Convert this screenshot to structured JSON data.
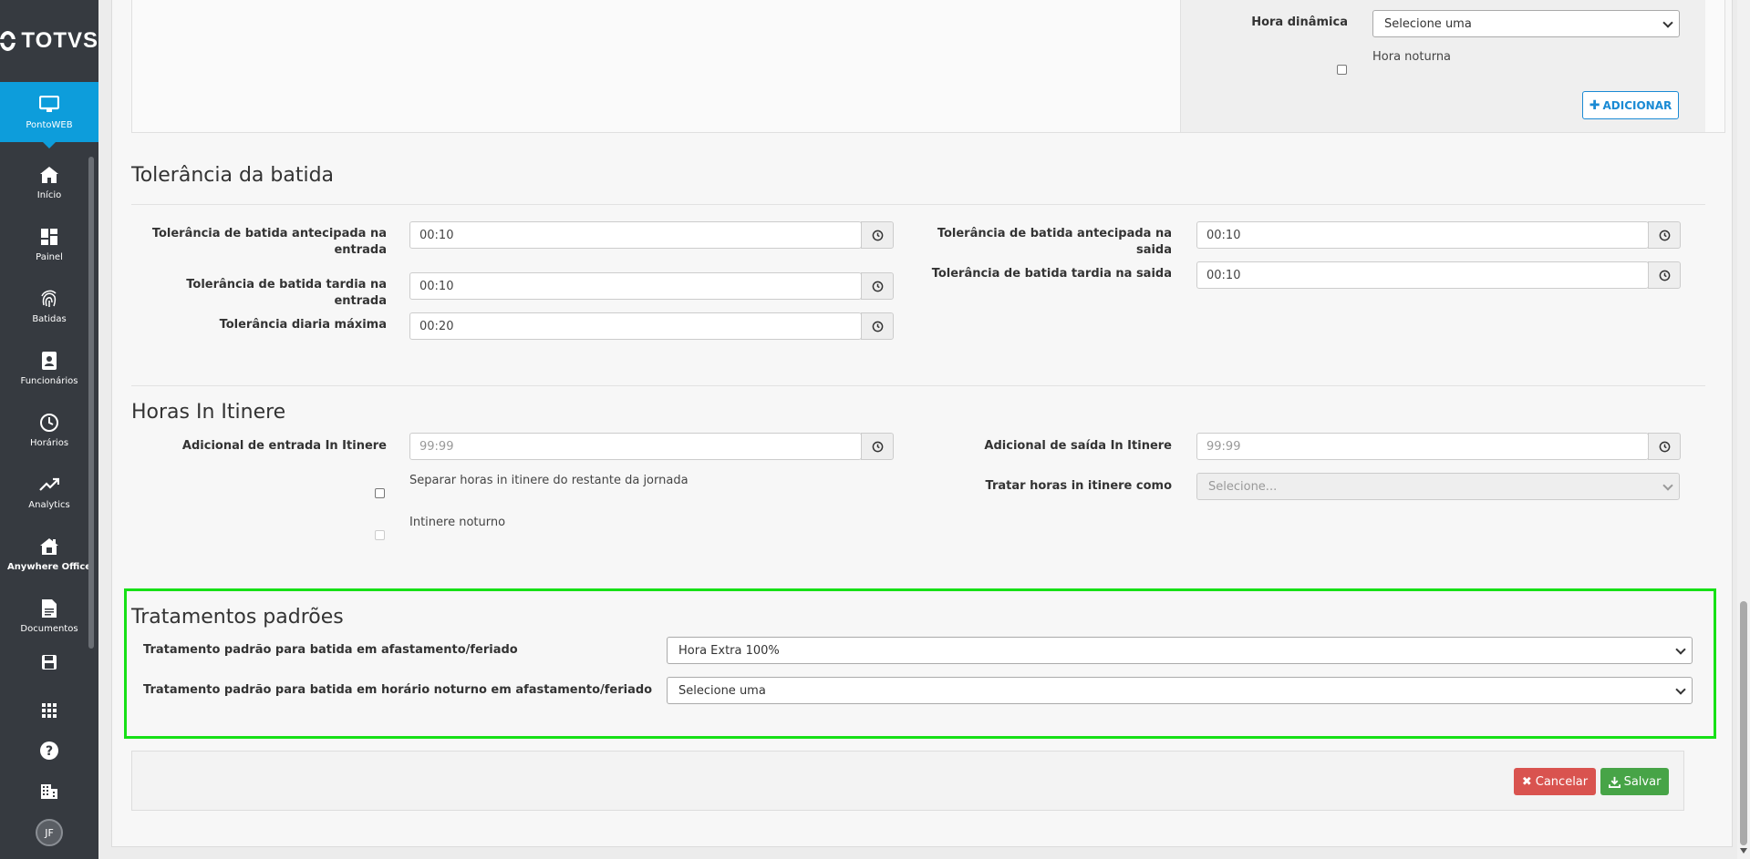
{
  "brand": {
    "name": "TOTVS"
  },
  "sidebar": {
    "active": {
      "label": "PontoWEB"
    },
    "items": [
      {
        "label": "Início",
        "icon": "home-icon"
      },
      {
        "label": "Painel",
        "icon": "dashboard-icon"
      },
      {
        "label": "Batidas",
        "icon": "fingerprint-icon"
      },
      {
        "label": "Funcionários",
        "icon": "badge-icon"
      },
      {
        "label": "Horários",
        "icon": "clock-icon"
      },
      {
        "label": "Analytics",
        "icon": "trend-icon"
      },
      {
        "label": "Anywhere Office",
        "icon": "home-office-icon"
      },
      {
        "label": "Documentos",
        "icon": "document-icon"
      }
    ],
    "user_initials": "JF"
  },
  "top_panel": {
    "hora_dinamica_label": "Hora dinâmica",
    "hora_dinamica_value": "Selecione uma",
    "hora_noturna_label": "Hora noturna",
    "add_button": "ADICIONAR"
  },
  "tolerancia": {
    "title": "Tolerância da batida",
    "antecipada_entrada_label": "Tolerância de batida antecipada na entrada",
    "antecipada_entrada_value": "00:10",
    "tardia_entrada_label": "Tolerância de batida tardia na entrada",
    "tardia_entrada_value": "00:10",
    "diaria_label": "Tolerância diaria máxima",
    "diaria_value": "00:20",
    "antecipada_saida_label": "Tolerância de batida antecipada na saida",
    "antecipada_saida_value": "00:10",
    "tardia_saida_label": "Tolerância de batida tardia na saida",
    "tardia_saida_value": "00:10"
  },
  "itinere": {
    "title": "Horas In Itinere",
    "entrada_label": "Adicional de entrada In Itinere",
    "entrada_placeholder": "99:99",
    "saida_label": "Adicional de saída In Itinere",
    "saida_placeholder": "99:99",
    "separar_label": "Separar horas in itinere do restante da jornada",
    "noturno_label": "Intinere noturno",
    "tratar_label": "Tratar horas in itinere como",
    "tratar_value": "Selecione..."
  },
  "tratamentos": {
    "title": "Tratamentos padrões",
    "afastamento_label": "Tratamento padrão para batida em afastamento/feriado",
    "afastamento_value": "Hora Extra 100%",
    "noturno_label": "Tratamento padrão para batida em horário noturno em afastamento/feriado",
    "noturno_value": "Selecione uma"
  },
  "footer": {
    "cancel": "Cancelar",
    "save": "Salvar"
  },
  "colors": {
    "sidebar_bg": "#363a40",
    "active_blue": "#0d9ddb",
    "highlight": "#16e016",
    "cancel_red": "#d9534f",
    "save_green": "#47a447"
  }
}
